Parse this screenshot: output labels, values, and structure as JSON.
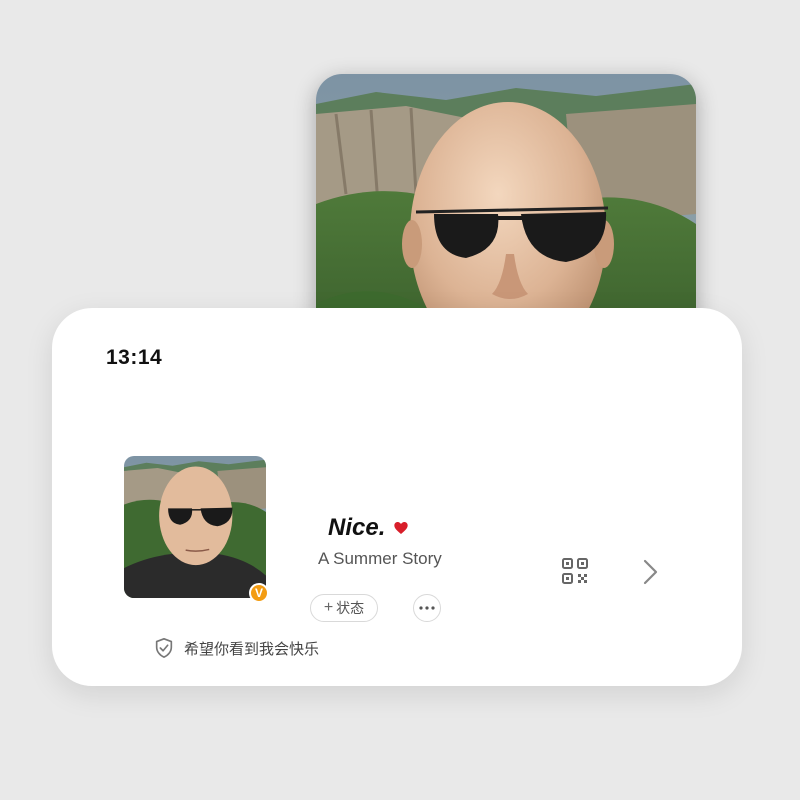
{
  "status_bar": {
    "time": "13:14"
  },
  "profile": {
    "nickname": "Nice.",
    "nickname_suffix_icon": "red-heart-icon",
    "signature": "A Summer Story",
    "vip_badge": "V",
    "status_button_plus": "+",
    "status_button_label": "状态",
    "more_icon": "more-dots-icon",
    "qr_icon": "qr-code-icon",
    "chevron_icon": "chevron-right-icon"
  },
  "footer": {
    "icon": "shield-check-icon",
    "note": "希望你看到我会快乐"
  },
  "colors": {
    "background": "#e9e9e9",
    "card": "#ffffff",
    "heart": "#d81e2a",
    "vip_badge": "#f39c12",
    "text_primary": "#111111",
    "text_secondary": "#555555"
  }
}
